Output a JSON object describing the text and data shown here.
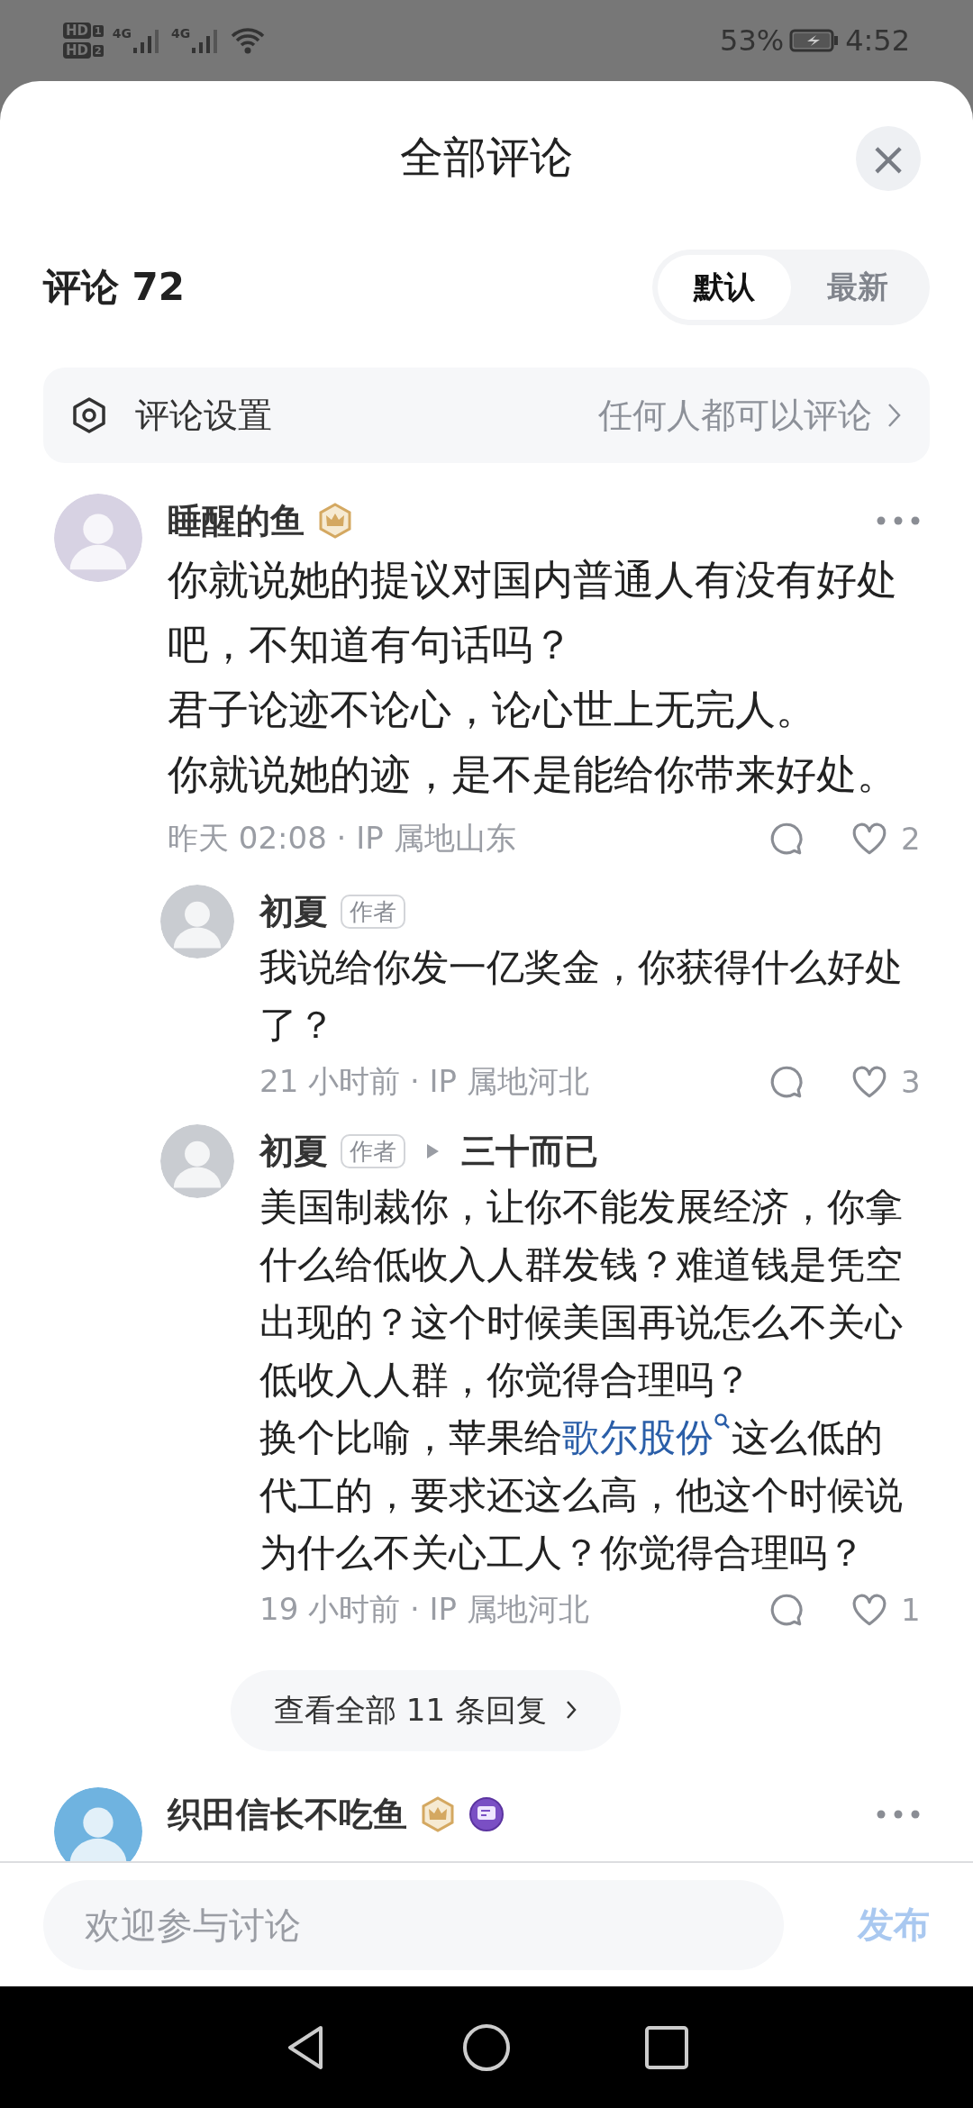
{
  "status_bar": {
    "sims": [
      {
        "badge": "HD",
        "slot": "1",
        "network": "4G"
      },
      {
        "badge": "HD",
        "slot": "2",
        "network": "4G"
      }
    ],
    "battery": "53%",
    "time": "4:52"
  },
  "sheet": {
    "title": "全部评论",
    "close": "×"
  },
  "comments_header": {
    "label": "评论 72",
    "sort_options": [
      {
        "label": "默认",
        "selected": true
      },
      {
        "label": "最新",
        "selected": false
      }
    ]
  },
  "settings": {
    "label": "评论设置",
    "value": "任何人都可以评论"
  },
  "comments": [
    {
      "user": "睡醒的鱼",
      "badges": [
        {
          "kind": "crown"
        }
      ],
      "paragraphs": [
        [
          {
            "kind": "text",
            "text": "你就说她的提议对国内普通人有没有好处吧，不知道有句话吗？"
          }
        ],
        [
          {
            "kind": "text",
            "text": "君子论迹不论心，论心世上无完人。"
          }
        ],
        [
          {
            "kind": "text",
            "text": "你就说她的迹，是不是能给你带来好处。"
          }
        ]
      ],
      "meta": "昨天 02:08 · IP 属地山东",
      "likes": "2",
      "replies": [
        {
          "user": "初夏",
          "tag": "作者",
          "paragraphs": [
            [
              {
                "kind": "text",
                "text": "我说给你发一亿奖金，你获得什么好处了？"
              }
            ]
          ],
          "meta": "21 小时前 · IP 属地河北",
          "likes": "3"
        },
        {
          "user": "初夏",
          "tag": "作者",
          "reply_to": "三十而已",
          "paragraphs": [
            [
              {
                "kind": "text",
                "text": "美国制裁你，让你不能发展经济，你拿什么给低收入人群发钱？难道钱是凭空出现的？这个时候美国再说怎么不关心低收入人群，你觉得合理吗？"
              }
            ],
            [
              {
                "kind": "text",
                "text": "换个比喻，苹果给"
              },
              {
                "kind": "link",
                "text": "歌尔股份"
              },
              {
                "kind": "text",
                "text": "这么低的代工的，要求还这么高，他这个时候说为什么不关心工人？你觉得合理吗？"
              }
            ]
          ],
          "meta": "19 小时前 · IP 属地河北",
          "likes": "1"
        }
      ],
      "more_replies": "查看全部 11 条回复"
    },
    {
      "user": "织田信长不吃鱼",
      "badges": [
        {
          "kind": "crown"
        },
        {
          "kind": "chat"
        }
      ]
    }
  ],
  "composer": {
    "placeholder": "欢迎参与讨论",
    "submit": "发布"
  }
}
